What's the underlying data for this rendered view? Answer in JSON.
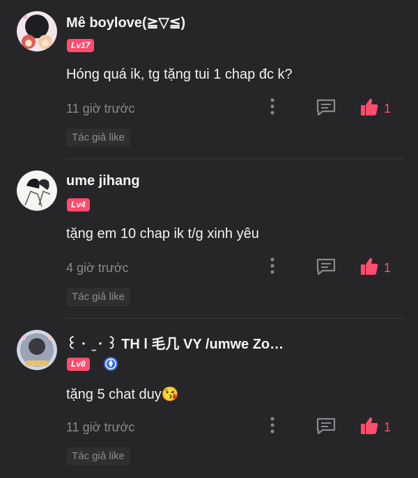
{
  "comments": [
    {
      "username": "Mê boylove(≧▽≦)",
      "level": "Lv17",
      "text": "Hóng quá ik, tg tặng tui 1 chap đc k?",
      "time": "11 giờ trước",
      "likes": "1",
      "author_like": "Tác giả like",
      "avatar_icon": "avatar-anime-couple-icon"
    },
    {
      "username": "ume jihang",
      "level": "Lv4",
      "text": "tặng em 10 chap ik t/g xinh yêu",
      "time": "4 giờ trước",
      "likes": "1",
      "author_like": "Tác giả like",
      "avatar_icon": "avatar-sketch-icon"
    },
    {
      "username": "꒰ㆍ ̫ㆍ꒱ TH l 毛几 VY /umwe Zou...",
      "level": "Lv8",
      "text": "tặng 5 chat duy😘",
      "time": "11 giờ trước",
      "likes": "1",
      "author_like": "Tác giả like",
      "avatar_icon": "avatar-framed-icon"
    }
  ],
  "colors": {
    "background": "#262628",
    "accent": "#ff4d6d",
    "muted": "#8a8a8e",
    "verify": "#3a6fe0"
  },
  "icons": {
    "more": "more-vertical-icon",
    "reply": "comment-reply-icon",
    "like": "thumbs-up-icon",
    "verify": "verified-badge-icon"
  }
}
